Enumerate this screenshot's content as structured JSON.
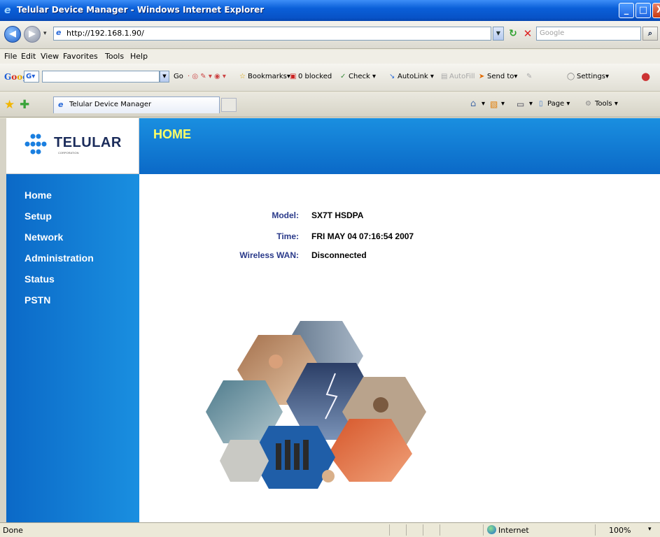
{
  "window": {
    "title": "Telular Device Manager - Windows Internet Explorer",
    "min": "_",
    "max": "□",
    "close": "X"
  },
  "address_bar": {
    "url": "http://192.168.1.90/",
    "search_placeholder": "Google"
  },
  "menu": [
    "File",
    "Edit",
    "View",
    "Favorites",
    "Tools",
    "Help"
  ],
  "google_toolbar": {
    "logo": "Google",
    "go": "Go",
    "bookmarks": "Bookmarks▾",
    "blocked": "0 blocked",
    "check": "Check ▾",
    "autolink": "AutoLink ▾",
    "autofill": "AutoFill",
    "send_to": "Send to▾",
    "settings": "Settings▾"
  },
  "tab": {
    "label": "Telular Device Manager"
  },
  "command_bar": {
    "page": "Page ▾",
    "tools": "Tools ▾"
  },
  "page": {
    "brand": "TELULAR",
    "brand_sub": "CORPORATION",
    "heading": "HOME",
    "nav": [
      "Home",
      "Setup",
      "Network",
      "Administration",
      "Status",
      "PSTN"
    ],
    "info": [
      {
        "label": "Model:",
        "value": "SX7T HSDPA"
      },
      {
        "label": "Time:",
        "value": "FRI MAY 04 07:16:54 2007"
      },
      {
        "label": "Wireless WAN:",
        "value": "Disconnected"
      }
    ]
  },
  "status_bar": {
    "status": "Done",
    "zone": "Internet",
    "zoom": "100%"
  },
  "colors": {
    "header_blue": "#0b69c7",
    "heading_yellow": "#ffff66",
    "label_blue": "#2a3a8a"
  }
}
